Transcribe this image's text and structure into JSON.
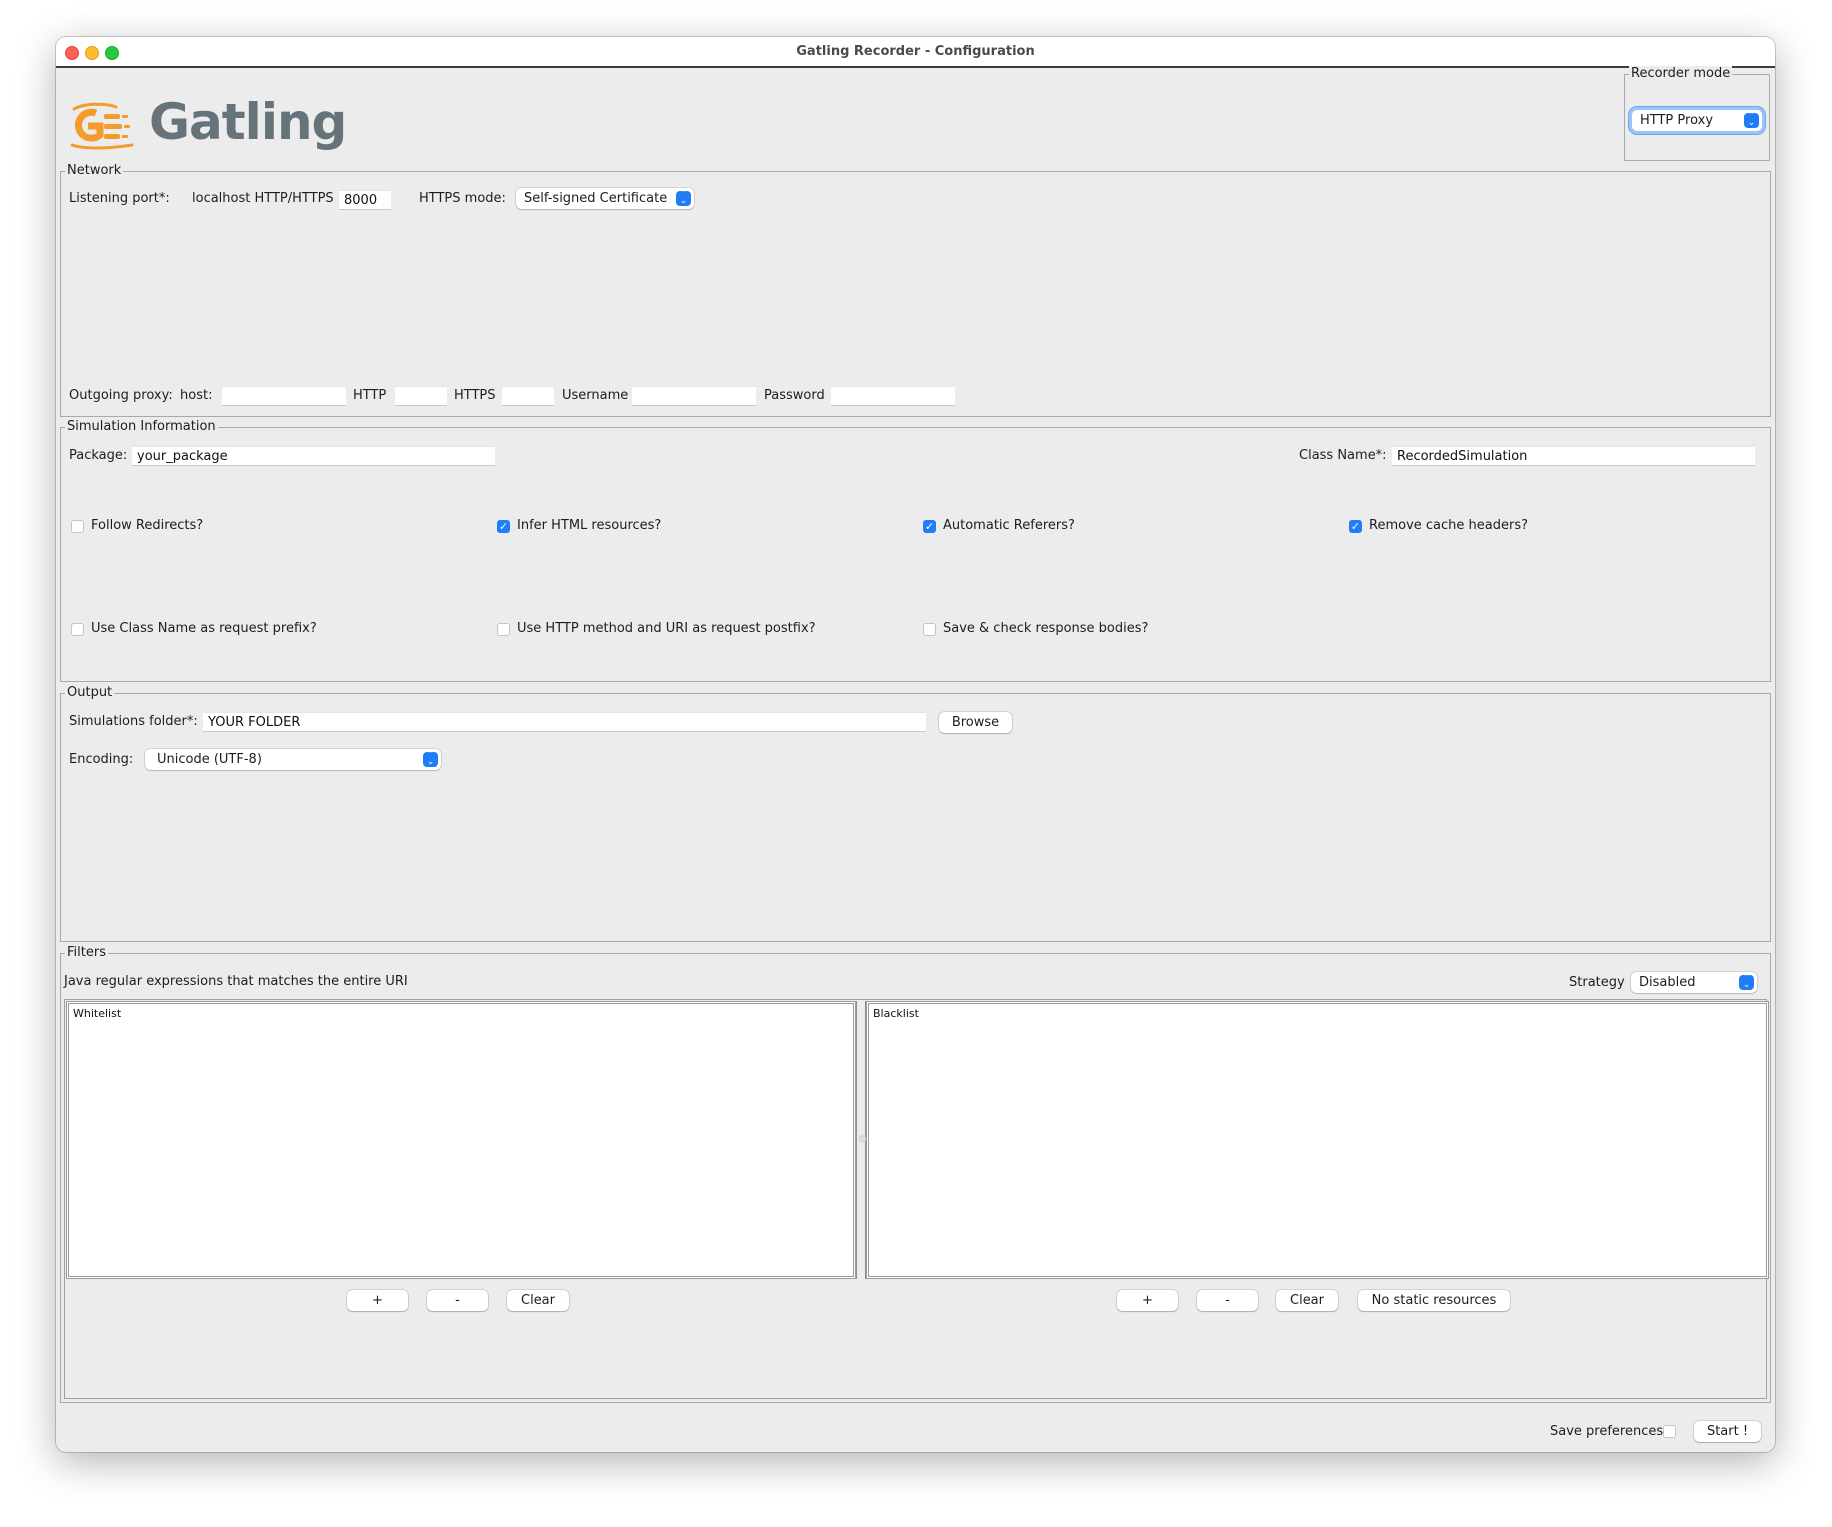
{
  "window": {
    "title": "Gatling Recorder - Configuration"
  },
  "logo": {
    "text": "Gatling",
    "brand_color": "#f39c2c",
    "text_color": "#66737b"
  },
  "recorder_mode": {
    "legend": "Recorder mode",
    "selected": "HTTP Proxy"
  },
  "network": {
    "legend": "Network",
    "listening_port_label": "Listening port*:",
    "localhost_label": "localhost HTTP/HTTPS",
    "port_value": "8000",
    "https_mode_label": "HTTPS mode:",
    "https_mode_selected": "Self-signed Certificate",
    "outgoing_proxy_label": "Outgoing proxy:",
    "host_label": "host:",
    "host_value": "",
    "http_label": "HTTP",
    "http_value": "",
    "https_label": "HTTPS",
    "https_value": "",
    "username_label": "Username",
    "username_value": "",
    "password_label": "Password",
    "password_value": ""
  },
  "simulation": {
    "legend": "Simulation Information",
    "package_label": "Package:",
    "package_value": "your_package",
    "class_name_label": "Class Name*:",
    "class_name_value": "RecordedSimulation",
    "checkboxes": [
      {
        "label": "Follow Redirects?",
        "checked": false
      },
      {
        "label": "Infer HTML resources?",
        "checked": true
      },
      {
        "label": "Automatic Referers?",
        "checked": true
      },
      {
        "label": "Remove cache headers?",
        "checked": true
      },
      {
        "label": "Use Class Name as request prefix?",
        "checked": false
      },
      {
        "label": "Use HTTP method and URI as request postfix?",
        "checked": false
      },
      {
        "label": "Save & check response bodies?",
        "checked": false
      }
    ]
  },
  "output": {
    "legend": "Output",
    "folder_label": "Simulations folder*:",
    "folder_value": "YOUR FOLDER",
    "browse_label": "Browse",
    "encoding_label": "Encoding:",
    "encoding_selected": "Unicode (UTF-8)"
  },
  "filters": {
    "legend": "Filters",
    "description": "Java regular expressions that matches the entire URI",
    "strategy_label": "Strategy",
    "strategy_selected": "Disabled",
    "whitelist": {
      "header": "Whitelist",
      "items": []
    },
    "blacklist": {
      "header": "Blacklist",
      "items": []
    },
    "add_label": "+",
    "remove_label": "-",
    "clear_label": "Clear",
    "no_static_label": "No static resources"
  },
  "footer": {
    "save_preferences_label": "Save preferences",
    "save_preferences_checked": false,
    "start_label": "Start !"
  }
}
